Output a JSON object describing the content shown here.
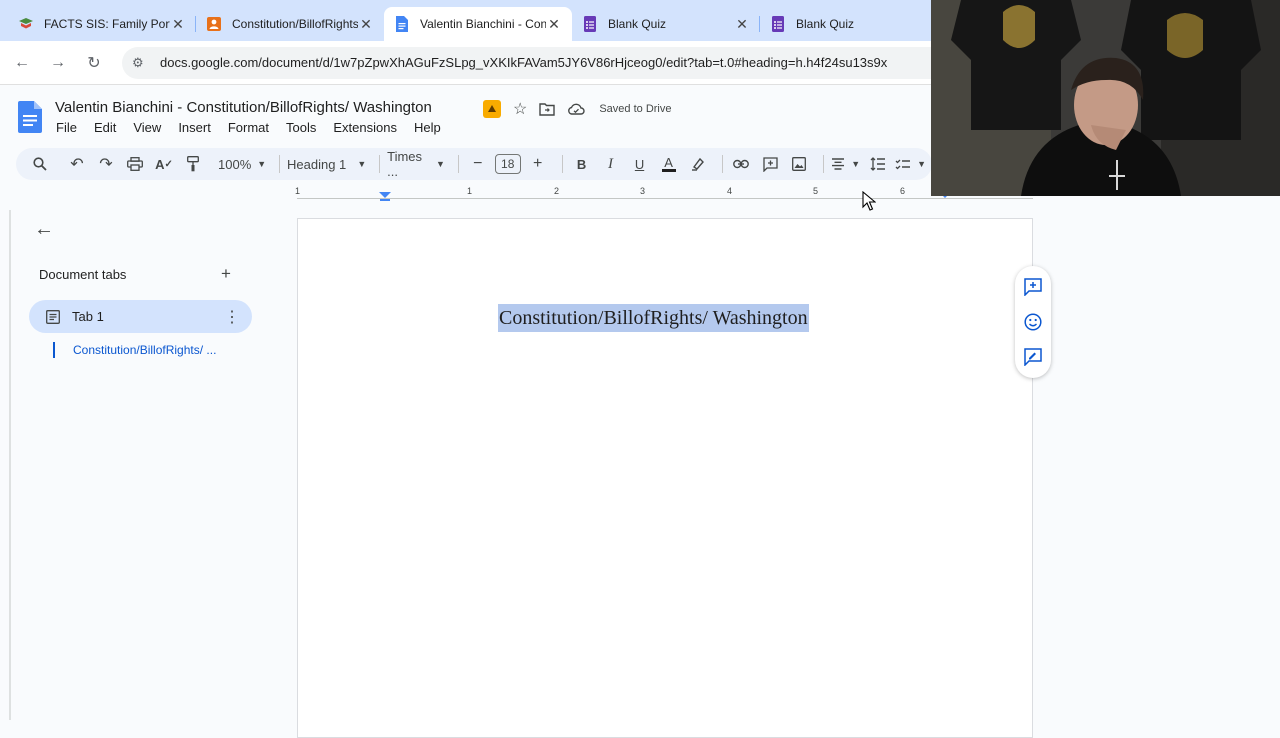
{
  "browser": {
    "tabs": [
      {
        "title": "FACTS SIS: Family Portal",
        "favicon": "facts-icon",
        "active": false
      },
      {
        "title": "Constitution/BillofRights",
        "favicon": "slides-icon",
        "active": false
      },
      {
        "title": "Valentin Bianchini - Constitution",
        "favicon": "docs-icon",
        "active": true
      },
      {
        "title": "Blank Quiz",
        "favicon": "forms-icon",
        "active": false
      },
      {
        "title": "Blank Quiz",
        "favicon": "forms-icon",
        "active": false
      }
    ],
    "url": "docs.google.com/document/d/1w7pZpwXhAGuFzSLpg_vXKIkFAVam5JY6V86rHjceog0/edit?tab=t.0#heading=h.h4f24su13s9x"
  },
  "doc": {
    "title": "Valentin Bianchini - Constitution/BillofRights/ Washington",
    "saved_status": "Saved to Drive",
    "menu": [
      "File",
      "Edit",
      "View",
      "Insert",
      "Format",
      "Tools",
      "Extensions",
      "Help"
    ]
  },
  "toolbar": {
    "zoom": "100%",
    "style": "Heading 1",
    "font": "Times ...",
    "font_size": "18"
  },
  "ruler": {
    "numbers": [
      "1",
      "1",
      "2",
      "3",
      "4",
      "5",
      "6"
    ]
  },
  "sidebar": {
    "document_tabs_label": "Document tabs",
    "tab1_label": "Tab 1",
    "outline_heading": "Constitution/BillofRights/ ..."
  },
  "page": {
    "heading_text": "Constitution/BillofRights/ Washington"
  },
  "colors": {
    "tabstrip": "#d3e3fd",
    "accent": "#0b57d0",
    "selection": "#b4c9ee",
    "toolbar": "#edf2fa"
  }
}
